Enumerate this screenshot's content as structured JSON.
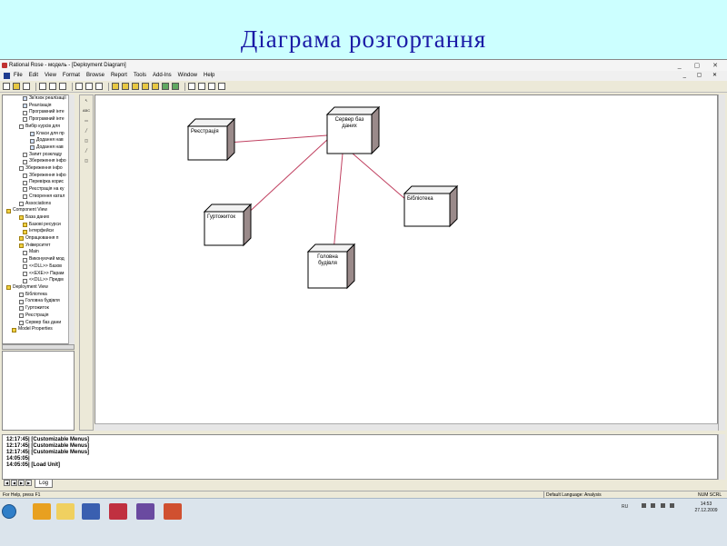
{
  "slide": {
    "title": "Діаграма розгортання"
  },
  "window": {
    "title": "Rational Rose - модель - [Deployment Diagram]",
    "controls": "_ ▢ ✕",
    "mdi_controls": "_ ▢ ✕"
  },
  "menu": [
    "File",
    "Edit",
    "View",
    "Format",
    "Browse",
    "Report",
    "Tools",
    "Add-Ins",
    "Window",
    "Help"
  ],
  "browser_tree": [
    "Зв'язок реалізації",
    "Реалізація",
    "Програмний інте",
    "Програмний інте",
    "Вибір курсів для",
    "Класи для пр",
    "Додання нав",
    "Додання нав",
    "Запит розкладу",
    "Збереження інфо",
    "Збереження інфо",
    "Збереження інфо",
    "Перевірка корис",
    "Реєстрація на ку",
    "Створення катал",
    "Associations",
    "Component View",
    "База даних",
    "Базові ресурси",
    "Інтерфейси",
    "Опрацювання п",
    "Університет",
    "Main",
    "Виконуючий мод",
    "<<DLL>> Базов",
    "<<EXE>> Парам",
    "<<DLL>> Предм",
    "Deployment View",
    "Бібліотека",
    "Головна будівля",
    "Гуртожиток",
    "Реєстрація",
    "Сервер баз дани",
    "Model Properties"
  ],
  "palette_tools": [
    "↖",
    "ABC",
    "▭",
    "╱",
    "◫",
    "╱",
    "◫"
  ],
  "diagram": {
    "nodes": [
      {
        "id": "registration",
        "label": "Реєстрація"
      },
      {
        "id": "db_server",
        "label": "Сервер баз даних"
      },
      {
        "id": "dormitory",
        "label": "Гуртожиток"
      },
      {
        "id": "library",
        "label": "Бібліотека"
      },
      {
        "id": "main_building",
        "label": "Головна будівля"
      }
    ],
    "links": [
      [
        "registration",
        "db_server"
      ],
      [
        "dormitory",
        "db_server"
      ],
      [
        "main_building",
        "db_server"
      ],
      [
        "library",
        "db_server"
      ]
    ],
    "node_color": "#000000",
    "link_color": "#c04060"
  },
  "log": {
    "lines": [
      "12:17:45|  [Customizable Menus]",
      "12:17:45|  [Customizable Menus]",
      "12:17:45|  [Customizable Menus]",
      "14:05:05|",
      "14:05:05|  [Load Unit]"
    ],
    "tab": "Log"
  },
  "status": {
    "help": "For Help, press F1",
    "language": "Default Language: Analysis",
    "indicators": "NUM  SCRL"
  },
  "tray": {
    "lang": "RU",
    "time": "14:53",
    "date": "27.12.2009"
  }
}
